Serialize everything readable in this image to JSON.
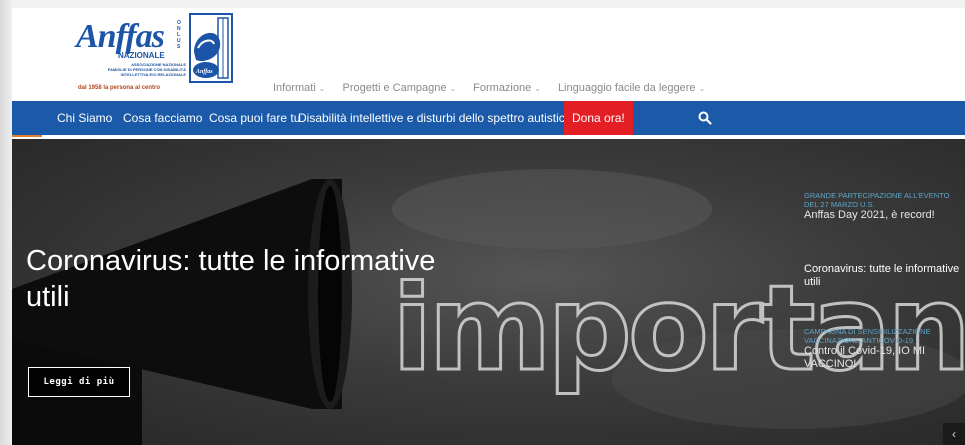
{
  "logo": {
    "brand": "Anffas",
    "onlus": "O N L U S",
    "nazionale": "NAZIONALE",
    "subtitle": "ASSOCIAZIONE NAZIONALE\nFAMIGLIE DI PERSONE CON DISABILITÀ\nINTELLETTIVA E/O RELAZIONALE",
    "tagline": "dal 1958 la persona al centro",
    "emblem_text": "Anffas"
  },
  "top_menu": [
    {
      "label": "Informati"
    },
    {
      "label": "Progetti e Campagne"
    },
    {
      "label": "Formazione"
    },
    {
      "label": "Linguaggio facile da leggere"
    }
  ],
  "nav": {
    "items": [
      {
        "label": "Chi Siamo"
      },
      {
        "label": "Cosa facciamo"
      },
      {
        "label": "Cosa puoi fare tu"
      },
      {
        "label": "Disabilità intellettive e disturbi dello spettro autistico"
      }
    ],
    "donate_label": "Dona ora!"
  },
  "hero": {
    "title": "Coronavirus: tutte le informative utili",
    "button_label": "Leggi di più",
    "background_word": "important"
  },
  "side_news": [
    {
      "kicker": "GRANDE PARTECIPAZIONE ALL'EVENTO DEL 27 MARZO U.S.",
      "title": "Anffas Day 2021, è record!"
    },
    {
      "kicker": "",
      "title": "Coronavirus: tutte le informative utili"
    },
    {
      "kicker": "CAMPAGNA DI SENSIBILIZZAZIONE VACCINAZIONE ANTICOVID-19",
      "title": "Contro il Covid-19, IO MI VACCINO!"
    }
  ],
  "colors": {
    "nav_blue": "#1b5aa8",
    "donate_red": "#e41e25",
    "brand_blue": "#1c55a8",
    "kicker_blue": "#5ea5c8"
  },
  "icons": {
    "search": "search-icon",
    "slider_prev": "chevron-left-icon"
  }
}
